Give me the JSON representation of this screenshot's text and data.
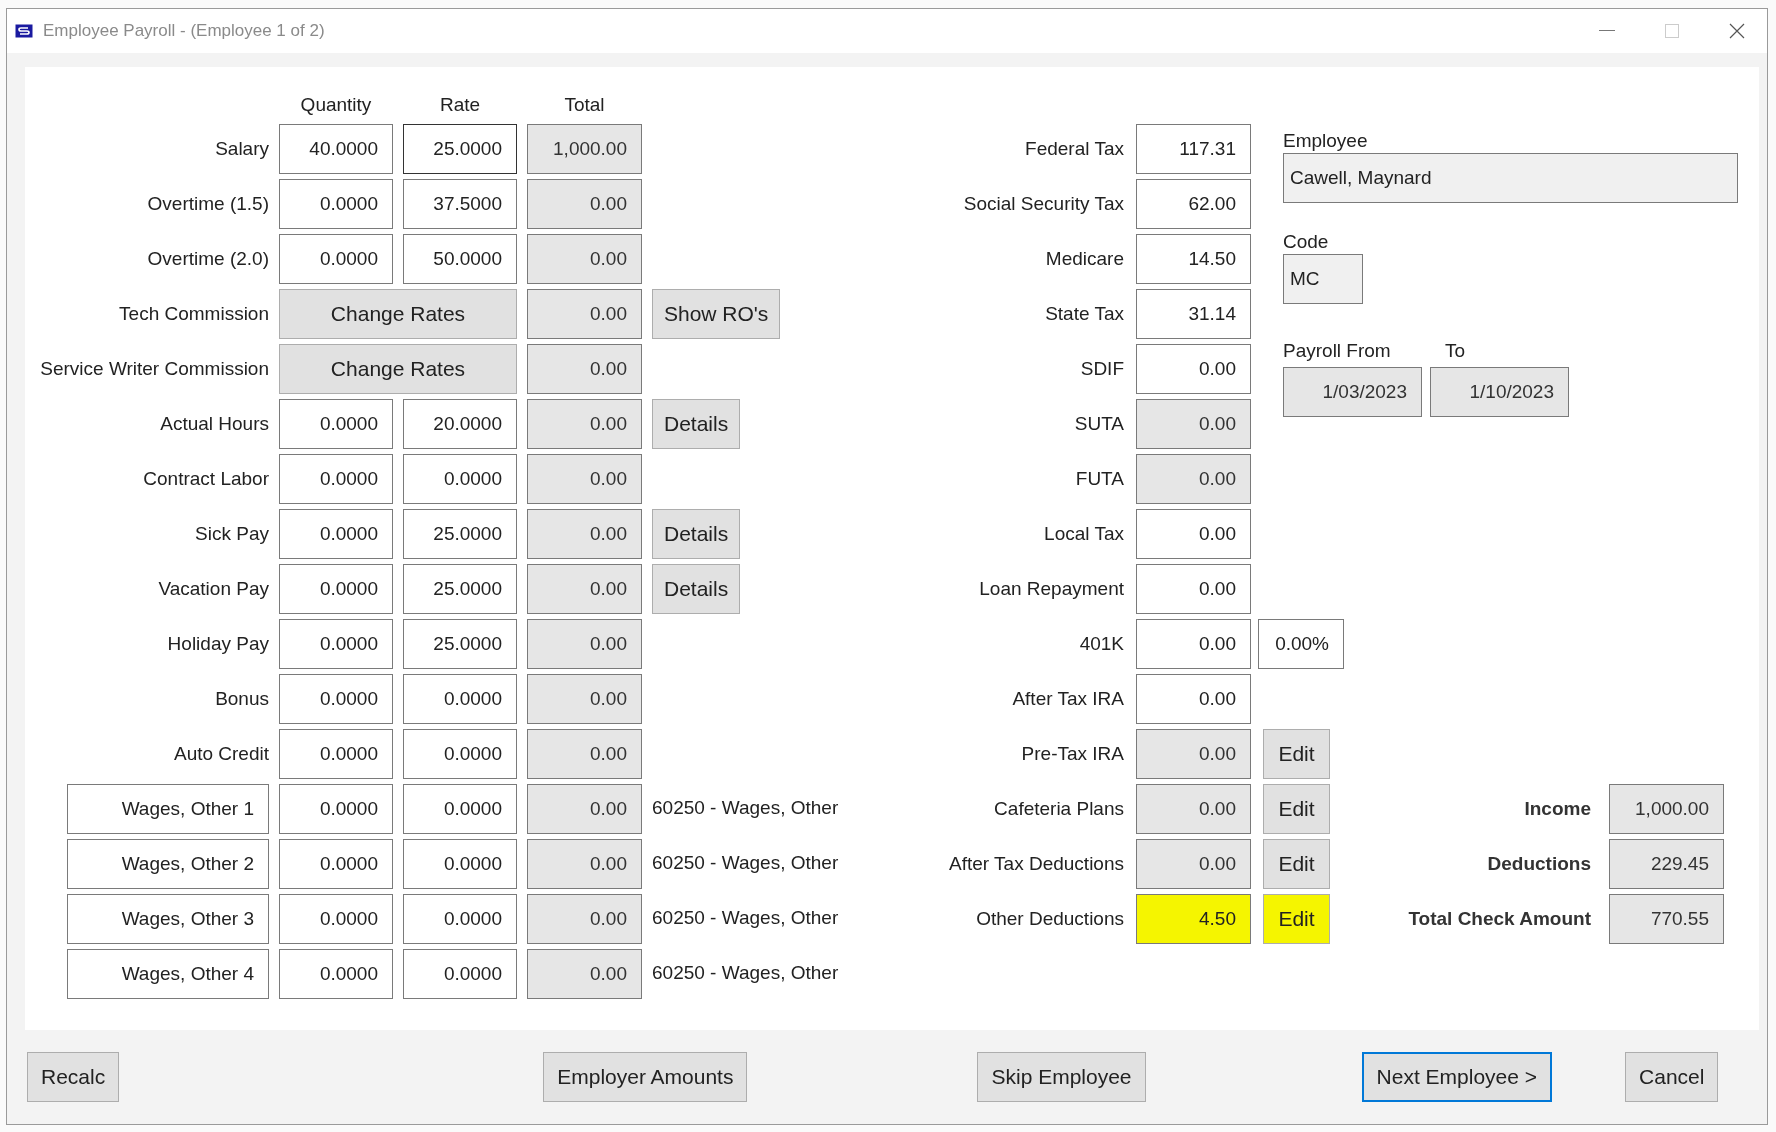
{
  "window": {
    "title": "Employee Payroll - (Employee 1 of 2)"
  },
  "earnings": {
    "columns": [
      "Quantity",
      "Rate",
      "Total"
    ],
    "rows": [
      {
        "kind": "plain",
        "label": "Salary",
        "quantity": "40.0000",
        "rate": "25.0000",
        "total": "1,000.00"
      },
      {
        "kind": "plain",
        "label": "Overtime (1.5)",
        "quantity": "0.0000",
        "rate": "37.5000",
        "total": "0.00"
      },
      {
        "kind": "plain",
        "label": "Overtime (2.0)",
        "quantity": "0.0000",
        "rate": "50.0000",
        "total": "0.00"
      },
      {
        "kind": "commission",
        "label": "Tech Commission",
        "button": "Change Rates",
        "total": "0.00",
        "extra": {
          "kind": "button",
          "text": "Show RO's"
        }
      },
      {
        "kind": "commission",
        "label": "Service Writer Commission",
        "button": "Change Rates",
        "total": "0.00"
      },
      {
        "kind": "plain",
        "label": "Actual Hours",
        "quantity": "0.0000",
        "rate": "20.0000",
        "total": "0.00",
        "extra": {
          "kind": "button",
          "text": "Details"
        }
      },
      {
        "kind": "plain",
        "label": "Contract Labor",
        "quantity": "0.0000",
        "rate": "0.0000",
        "total": "0.00"
      },
      {
        "kind": "plain",
        "label": "Sick Pay",
        "quantity": "0.0000",
        "rate": "25.0000",
        "total": "0.00",
        "extra": {
          "kind": "button",
          "text": "Details"
        }
      },
      {
        "kind": "plain",
        "label": "Vacation Pay",
        "quantity": "0.0000",
        "rate": "25.0000",
        "total": "0.00",
        "extra": {
          "kind": "button",
          "text": "Details"
        }
      },
      {
        "kind": "plain",
        "label": "Holiday Pay",
        "quantity": "0.0000",
        "rate": "25.0000",
        "total": "0.00"
      },
      {
        "kind": "plain",
        "label": "Bonus",
        "quantity": "0.0000",
        "rate": "0.0000",
        "total": "0.00"
      },
      {
        "kind": "plain",
        "label": "Auto Credit",
        "quantity": "0.0000",
        "rate": "0.0000",
        "total": "0.00"
      },
      {
        "kind": "custom",
        "label": "Wages, Other 1",
        "quantity": "0.0000",
        "rate": "0.0000",
        "total": "0.00",
        "extra": {
          "kind": "text",
          "text": "60250 - Wages, Other"
        }
      },
      {
        "kind": "custom",
        "label": "Wages, Other 2",
        "quantity": "0.0000",
        "rate": "0.0000",
        "total": "0.00",
        "extra": {
          "kind": "text",
          "text": "60250 - Wages, Other"
        }
      },
      {
        "kind": "custom",
        "label": "Wages, Other 3",
        "quantity": "0.0000",
        "rate": "0.0000",
        "total": "0.00",
        "extra": {
          "kind": "text",
          "text": "60250 - Wages, Other"
        }
      },
      {
        "kind": "custom",
        "label": "Wages, Other 4",
        "quantity": "0.0000",
        "rate": "0.0000",
        "total": "0.00",
        "extra": {
          "kind": "text",
          "text": "60250 - Wages, Other"
        }
      }
    ]
  },
  "deductions": [
    {
      "label": "Federal Tax",
      "value": "117.31",
      "disabled": false,
      "highlighted": false
    },
    {
      "label": "Social Security Tax",
      "value": "62.00",
      "disabled": false,
      "highlighted": false
    },
    {
      "label": "Medicare",
      "value": "14.50",
      "disabled": false,
      "highlighted": false
    },
    {
      "label": "State Tax",
      "value": "31.14",
      "disabled": false,
      "highlighted": false
    },
    {
      "label": "SDIF",
      "value": "0.00",
      "disabled": false,
      "highlighted": false
    },
    {
      "label": "SUTA",
      "value": "0.00",
      "disabled": true,
      "highlighted": false
    },
    {
      "label": "FUTA",
      "value": "0.00",
      "disabled": true,
      "highlighted": false
    },
    {
      "label": "Local Tax",
      "value": "0.00",
      "disabled": false,
      "highlighted": false
    },
    {
      "label": "Loan Repayment",
      "value": "0.00",
      "disabled": false,
      "highlighted": false
    },
    {
      "label": "401K",
      "value": "0.00",
      "disabled": false,
      "highlighted": false,
      "extra": {
        "kind": "field",
        "text": "0.00%",
        "highlighted": false
      }
    },
    {
      "label": "After Tax IRA",
      "value": "0.00",
      "disabled": false,
      "highlighted": false
    },
    {
      "label": "Pre-Tax IRA",
      "value": "0.00",
      "disabled": true,
      "highlighted": false,
      "extra": {
        "kind": "button",
        "text": "Edit",
        "highlighted": false
      }
    },
    {
      "label": "Cafeteria Plans",
      "value": "0.00",
      "disabled": true,
      "highlighted": false,
      "extra": {
        "kind": "button",
        "text": "Edit",
        "highlighted": false
      }
    },
    {
      "label": "After Tax Deductions",
      "value": "0.00",
      "disabled": true,
      "highlighted": false,
      "extra": {
        "kind": "button",
        "text": "Edit",
        "highlighted": false
      }
    },
    {
      "label": "Other Deductions",
      "value": "4.50",
      "disabled": true,
      "highlighted": true,
      "extra": {
        "kind": "button",
        "text": "Edit",
        "highlighted": true
      }
    }
  ],
  "employee": {
    "label": "Employee",
    "value": "Cawell, Maynard"
  },
  "code": {
    "label": "Code",
    "value": "MC"
  },
  "payroll": {
    "from_label": "Payroll From",
    "to_label": "To",
    "from": "1/03/2023",
    "to": "1/10/2023"
  },
  "totals": [
    {
      "label": "Income",
      "value": "1,000.00"
    },
    {
      "label": "Deductions",
      "value": "229.45"
    },
    {
      "label": "Total Check Amount",
      "value": "770.55"
    }
  ],
  "footer_buttons": [
    {
      "label": "Recalc",
      "default": false
    },
    {
      "label": "Employer Amounts",
      "default": false
    },
    {
      "label": "Skip Employee",
      "default": false
    },
    {
      "label": "Next Employee >",
      "default": true
    },
    {
      "label": "Cancel",
      "default": false
    }
  ]
}
